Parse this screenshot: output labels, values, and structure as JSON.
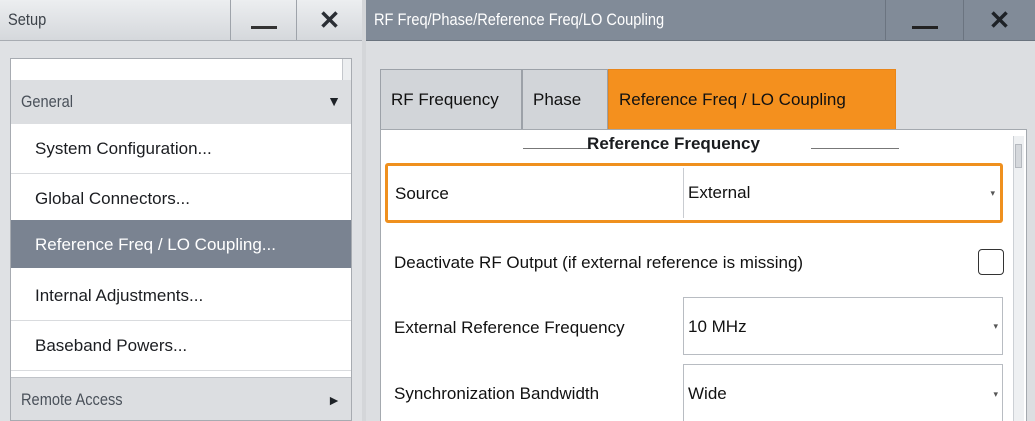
{
  "setup_window": {
    "title": "Setup",
    "minimize_glyph": "—",
    "close_glyph": "✕",
    "groups": [
      {
        "label": "General",
        "expanded": true,
        "arrow": "▼",
        "items": [
          {
            "label": "System Configuration...",
            "selected": false
          },
          {
            "label": "Global Connectors...",
            "selected": false
          },
          {
            "label": "Reference Freq / LO Coupling...",
            "selected": true
          },
          {
            "label": "Internal Adjustments...",
            "selected": false
          },
          {
            "label": "Baseband Powers...",
            "selected": false
          }
        ]
      },
      {
        "label": "Remote Access",
        "expanded": false,
        "arrow": "►"
      }
    ]
  },
  "rf_window": {
    "title": "RF Freq/Phase/Reference Freq/LO Coupling",
    "close_glyph": "✕",
    "tabs": [
      {
        "label": "RF Frequency",
        "active": false
      },
      {
        "label": "Phase",
        "active": false
      },
      {
        "label": "Reference Freq / LO Coupling",
        "active": true
      }
    ],
    "section_title": "Reference Frequency",
    "source": {
      "label": "Source",
      "value": "External"
    },
    "deactivate_rf": {
      "label": "Deactivate RF Output (if external reference is missing)",
      "checked": false
    },
    "ext_ref_freq": {
      "label": "External Reference Frequency",
      "value": "10 MHz"
    },
    "sync_bandwidth": {
      "label": "Synchronization Bandwidth",
      "value": "Wide"
    },
    "dropdown_caret": "▾"
  },
  "colors": {
    "accent_orange": "#f4901e",
    "selected_item_bg": "#7a8391",
    "active_titlebar": "#818b98"
  }
}
